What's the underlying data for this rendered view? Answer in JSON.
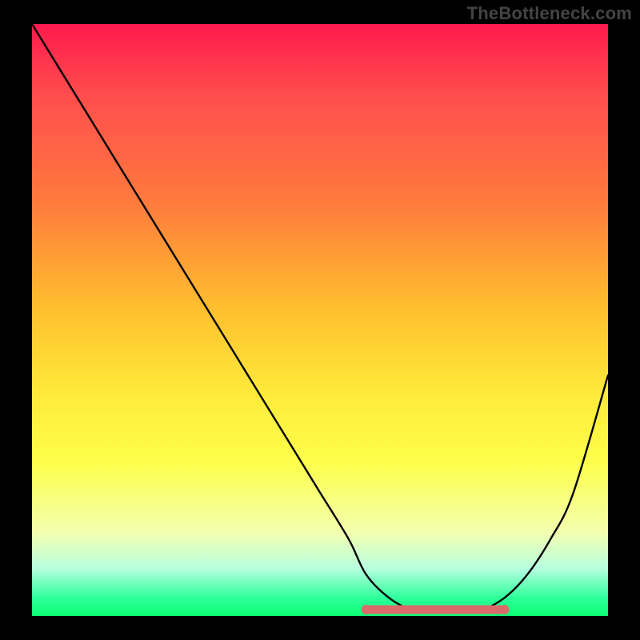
{
  "attribution": "TheBottleneck.com",
  "colors": {
    "background": "#000000",
    "gradient_top": "#ff1a4d",
    "gradient_mid": "#ffe93a",
    "gradient_bottom": "#0cff74",
    "curve": "#000000",
    "flat_segment": "#d96b6b"
  },
  "chart_data": {
    "type": "line",
    "title": "",
    "xlabel": "",
    "ylabel": "",
    "xlim": [
      0,
      100
    ],
    "ylim": [
      0,
      100
    ],
    "x": [
      0,
      5,
      10,
      15,
      20,
      25,
      30,
      35,
      40,
      45,
      50,
      55,
      58,
      62,
      66,
      70,
      74,
      78,
      82,
      86,
      90,
      94,
      100
    ],
    "y": [
      100,
      92,
      84,
      76,
      68,
      60,
      52,
      44,
      36,
      28,
      20,
      12,
      6,
      2,
      0,
      0,
      0,
      0,
      2,
      6,
      12,
      20,
      40
    ],
    "flat_segment": {
      "x_start": 58,
      "x_end": 82,
      "y": 0
    },
    "annotations": []
  }
}
